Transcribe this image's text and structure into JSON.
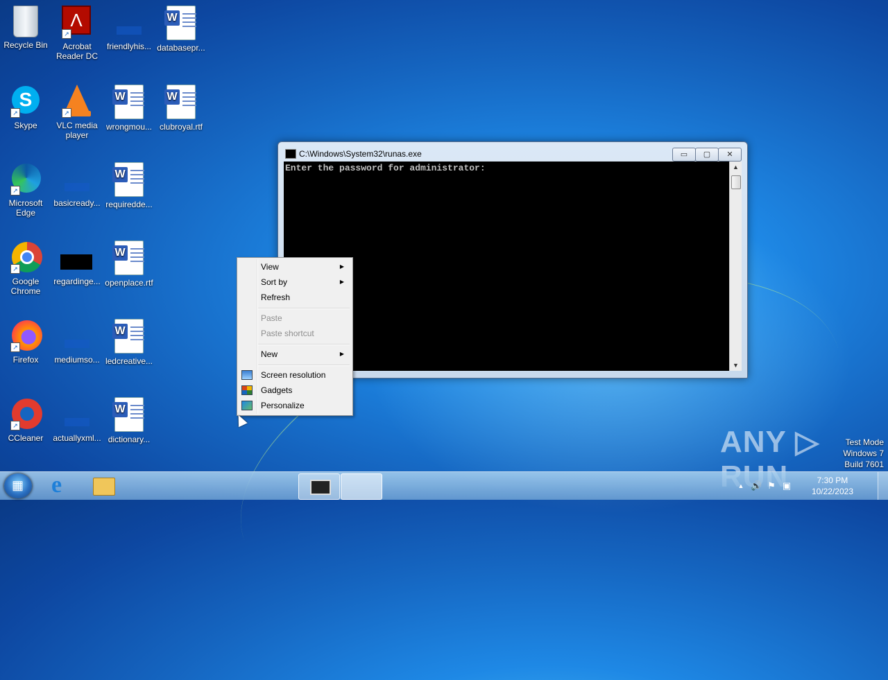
{
  "desktop_icons": [
    {
      "name": "recycle-bin",
      "label": "Recycle Bin"
    },
    {
      "name": "acrobat-reader",
      "label": "Acrobat Reader DC"
    },
    {
      "name": "friendlyhis",
      "label": "friendlyhis..."
    },
    {
      "name": "databasepr",
      "label": "databasepr..."
    },
    {
      "name": "skype",
      "label": "Skype"
    },
    {
      "name": "vlc",
      "label": "VLC media player"
    },
    {
      "name": "wrongmou",
      "label": "wrongmou..."
    },
    {
      "name": "clubroyal",
      "label": "clubroyal.rtf"
    },
    {
      "name": "edge",
      "label": "Microsoft Edge"
    },
    {
      "name": "basicready",
      "label": "basicready..."
    },
    {
      "name": "requiredde",
      "label": "requiredde..."
    },
    {
      "name": "chrome",
      "label": "Google Chrome"
    },
    {
      "name": "regardinge",
      "label": "regardinge..."
    },
    {
      "name": "openplace",
      "label": "openplace.rtf"
    },
    {
      "name": "firefox",
      "label": "Firefox"
    },
    {
      "name": "mediumso",
      "label": "mediumso..."
    },
    {
      "name": "ledcreative",
      "label": "ledcreative..."
    },
    {
      "name": "ccleaner",
      "label": "CCleaner"
    },
    {
      "name": "actuallyxml",
      "label": "actuallyxml..."
    },
    {
      "name": "dictionary",
      "label": "dictionary..."
    }
  ],
  "console_window": {
    "title": "C:\\Windows\\System32\\runas.exe",
    "text": "Enter the password for administrator:",
    "buttons": {
      "minimize": "▭",
      "maximize": "▢",
      "close": "✕"
    }
  },
  "context_menu": {
    "items": [
      {
        "label": "View",
        "submenu": true
      },
      {
        "label": "Sort by",
        "submenu": true
      },
      {
        "label": "Refresh"
      },
      {
        "label": "Paste",
        "disabled": true
      },
      {
        "label": "Paste shortcut",
        "disabled": true
      },
      {
        "label": "New",
        "submenu": true
      },
      {
        "label": "Screen resolution",
        "icon": "screen-resolution-icon"
      },
      {
        "label": "Gadgets",
        "icon": "gadgets-icon"
      },
      {
        "label": "Personalize",
        "icon": "personalize-icon"
      }
    ],
    "arrow": "▶"
  },
  "watermark": "ANY ▷ RUN",
  "test_mode": {
    "line1": "Test Mode",
    "line2": "Windows 7",
    "line3": "Build 7601"
  },
  "tray": {
    "time": "7:30 PM",
    "date": "10/22/2023",
    "up_arrow": "▲",
    "speaker": "🔊",
    "flag": "⚑",
    "network": "▣"
  }
}
